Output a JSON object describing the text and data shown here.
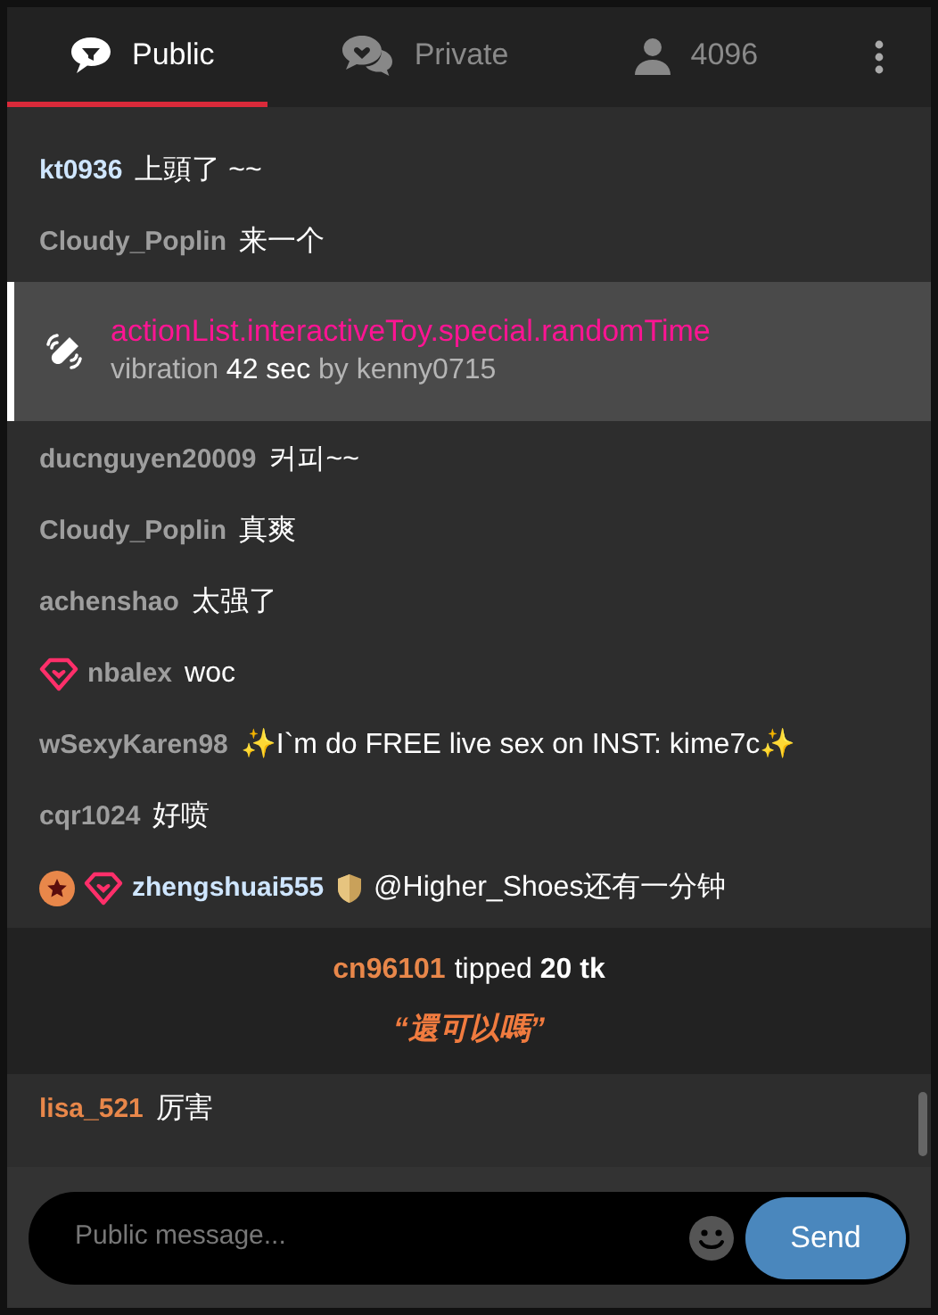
{
  "tabs": [
    {
      "label": "Public",
      "selected": true
    },
    {
      "label": "Private",
      "selected": false
    },
    {
      "label": "4096",
      "selected": false
    }
  ],
  "messages": [
    {
      "kind": "chat",
      "user": "kt0936",
      "color": "#cfe6ff",
      "star_badge": false,
      "heart_badge": false,
      "shield_badge": false,
      "text": "上頭了 ~~"
    },
    {
      "kind": "chat",
      "user": "Cloudy_Poplin",
      "color": "#9e9e9e",
      "star_badge": false,
      "heart_badge": false,
      "shield_badge": false,
      "text": "来一个"
    },
    {
      "kind": "action",
      "title": "actionList.interactiveToy.special.randomTime",
      "detail": "vibration **42 sec** by kenny0715"
    },
    {
      "kind": "chat",
      "user": "ducnguyen20009",
      "color": "#9e9e9e",
      "star_badge": false,
      "heart_badge": false,
      "shield_badge": false,
      "text": "커피~~"
    },
    {
      "kind": "chat",
      "user": "Cloudy_Poplin",
      "color": "#9e9e9e",
      "star_badge": false,
      "heart_badge": false,
      "shield_badge": false,
      "text": "真爽"
    },
    {
      "kind": "chat",
      "user": "achenshao",
      "color": "#9e9e9e",
      "star_badge": false,
      "heart_badge": false,
      "shield_badge": false,
      "text": "太强了"
    },
    {
      "kind": "chat",
      "user": "nbalex",
      "color": "#9e9e9e",
      "star_badge": false,
      "heart_badge": true,
      "shield_badge": false,
      "text": "woc"
    },
    {
      "kind": "chat",
      "user": "wSexyKaren98",
      "color": "#9e9e9e",
      "star_badge": false,
      "heart_badge": false,
      "shield_badge": false,
      "text": "✨I`m do FREE live sex on INST: kime7c✨"
    },
    {
      "kind": "chat",
      "user": "cqr1024",
      "color": "#9e9e9e",
      "star_badge": false,
      "heart_badge": false,
      "shield_badge": false,
      "text": "好喷"
    },
    {
      "kind": "chat",
      "user": "zhengshuai555",
      "color": "#cfe6ff",
      "star_badge": true,
      "heart_badge": true,
      "shield_badge": true,
      "text": "@Higher_Shoes还有一分钟"
    },
    {
      "kind": "tip",
      "user": "cn96101",
      "text": "tipped **20 tk**",
      "note": "“還可以嗎”"
    },
    {
      "kind": "chat",
      "user": "lisa_521",
      "color": "#e8874a",
      "star_badge": false,
      "heart_badge": false,
      "shield_badge": false,
      "text": "厉害"
    }
  ],
  "composer": {
    "placeholder": "Public message...",
    "send": "Send"
  }
}
